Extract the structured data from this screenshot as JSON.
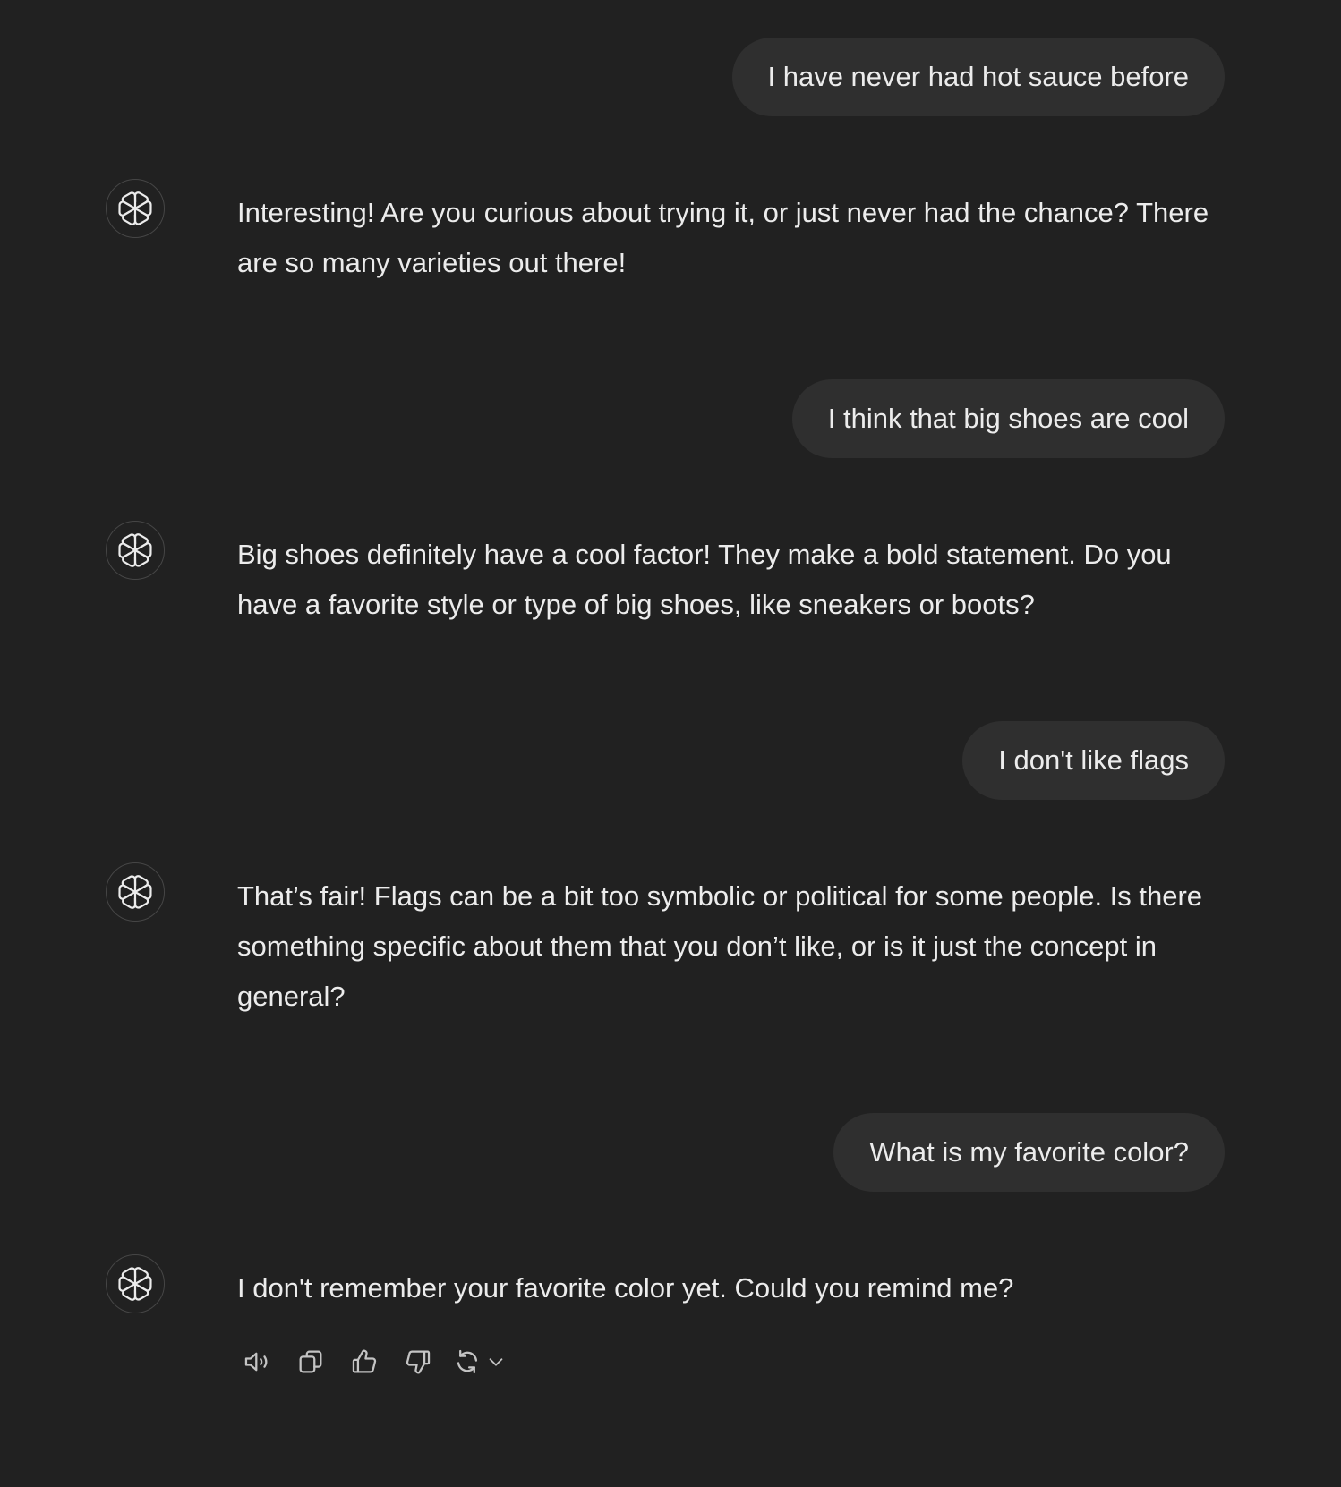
{
  "theme": {
    "background": "#212121",
    "user_bubble": "#2f2f2f",
    "text": "#ececec",
    "icon": "#c4c4c4"
  },
  "messages": [
    {
      "role": "user",
      "text": "I have never had hot sauce before"
    },
    {
      "role": "assistant",
      "avatar_icon": "openai-logo-icon",
      "text": "Interesting! Are you curious about trying it, or just never had the chance? There are so many varieties out there!"
    },
    {
      "role": "user",
      "text": "I think that big shoes are cool"
    },
    {
      "role": "assistant",
      "avatar_icon": "openai-logo-icon",
      "text": "Big shoes definitely have a cool factor! They make a bold statement. Do you have a favorite style or type of big shoes, like sneakers or boots?"
    },
    {
      "role": "user",
      "text": "I don't like flags"
    },
    {
      "role": "assistant",
      "avatar_icon": "openai-logo-icon",
      "text": "That’s fair! Flags can be a bit too symbolic or political for some people. Is there something specific about them that you don’t like, or is it just the concept in general?"
    },
    {
      "role": "user",
      "text": "What is my favorite color?"
    },
    {
      "role": "assistant",
      "avatar_icon": "openai-logo-icon",
      "text": "I don't remember your favorite color yet. Could you remind me?"
    }
  ],
  "actions": [
    {
      "icon": "speaker-icon"
    },
    {
      "icon": "copy-icon"
    },
    {
      "icon": "thumbs-up-icon"
    },
    {
      "icon": "thumbs-down-icon"
    },
    {
      "icon": "regenerate-icon"
    },
    {
      "icon": "chevron-down-icon"
    }
  ]
}
